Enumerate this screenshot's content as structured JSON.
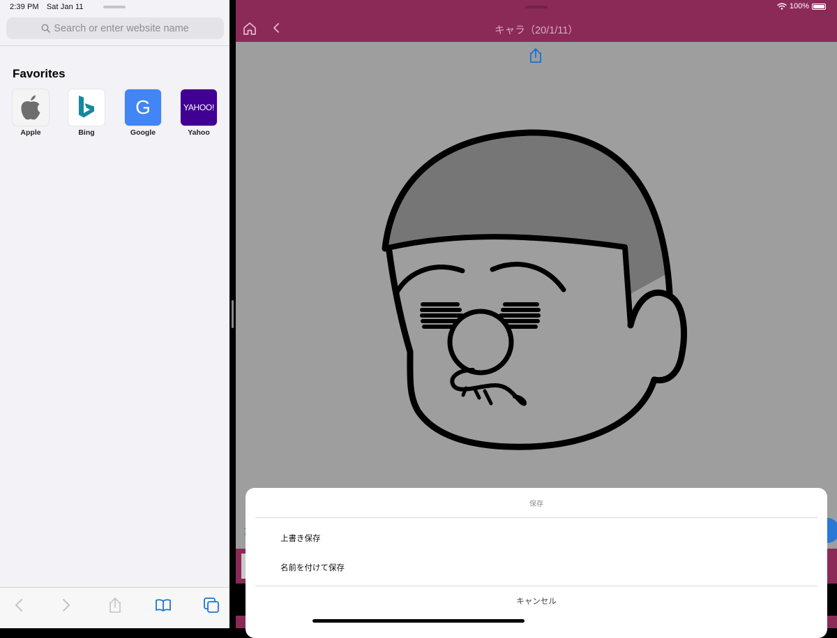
{
  "left_pane": {
    "status": {
      "time": "2:39 PM",
      "date": "Sat Jan 11"
    },
    "search": {
      "placeholder": "Search or enter website name"
    },
    "favorites": {
      "title": "Favorites",
      "items": [
        {
          "label": "Apple",
          "icon": "apple-logo-icon"
        },
        {
          "label": "Bing",
          "icon": "bing-logo-icon",
          "color": "#138a9c"
        },
        {
          "label": "Google",
          "icon": "google-logo-icon",
          "color": "#4285f4",
          "glyph": "G"
        },
        {
          "label": "Yahoo",
          "icon": "yahoo-logo-icon",
          "color": "#410093",
          "glyph": "YAHOO!"
        }
      ]
    },
    "toolbar": {
      "icons": [
        "back-icon",
        "forward-icon",
        "share-icon",
        "bookmarks-icon",
        "tabs-icon"
      ]
    }
  },
  "right_pane": {
    "status": {
      "battery": "100%"
    },
    "navbar": {
      "title": "キャラ（20/1/11）",
      "bar_color": "#8b2a57"
    },
    "icons": [
      "home-icon",
      "chevron-left-icon",
      "share-icon"
    ],
    "action_sheet": {
      "title": "保存",
      "options": [
        "上書き保存",
        "名前を付けて保存"
      ],
      "cancel": "キャンセル"
    }
  }
}
